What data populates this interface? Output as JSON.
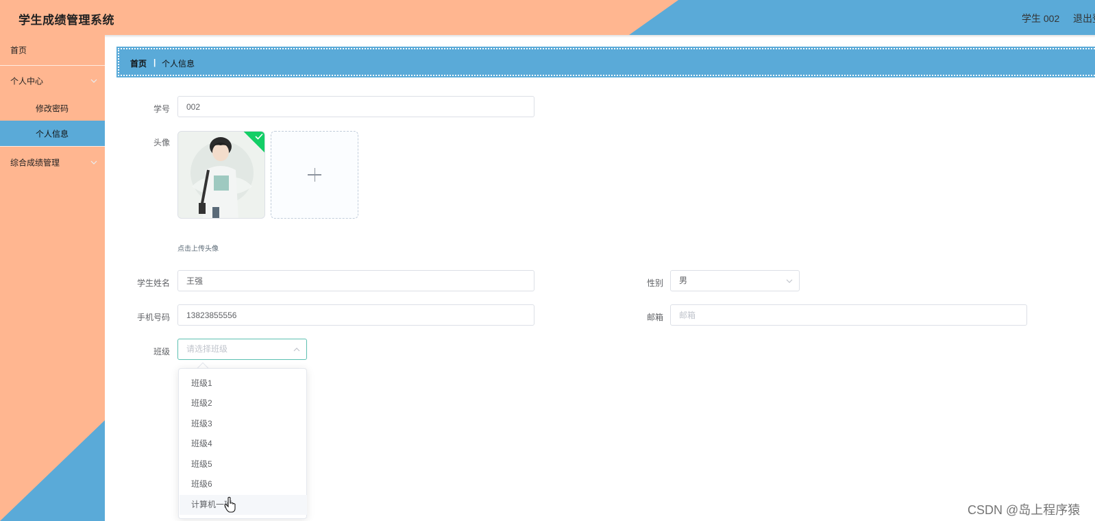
{
  "header": {
    "app_title": "学生成绩管理系统",
    "user": "学生 002",
    "logout": "退出登录"
  },
  "sidebar": {
    "items": [
      {
        "label": "首页"
      },
      {
        "label": "个人中心"
      },
      {
        "label": "修改密码"
      },
      {
        "label": "个人信息",
        "active": true
      },
      {
        "label": "综合成绩管理"
      }
    ]
  },
  "breadcrumb": {
    "home": "首页",
    "separator": "|",
    "current": "个人信息"
  },
  "form": {
    "student_id": {
      "label": "学号",
      "value": "002"
    },
    "avatar": {
      "label": "头像",
      "upload_tip": "点击上传头像"
    },
    "student_name": {
      "label": "学生姓名",
      "value": "王强"
    },
    "gender": {
      "label": "性别",
      "value": "男"
    },
    "phone": {
      "label": "手机号码",
      "value": "13823855556"
    },
    "email": {
      "label": "邮箱",
      "placeholder": "邮箱"
    },
    "class": {
      "label": "班级",
      "placeholder": "请选择班级",
      "options": [
        "班级1",
        "班级2",
        "班级3",
        "班级4",
        "班级5",
        "班级6",
        "计算机一班"
      ]
    }
  },
  "watermark": "CSDN @岛上程序猿",
  "colors": {
    "peach": "#ffb690",
    "blue": "#5aaad8",
    "success": "#13ce66"
  }
}
